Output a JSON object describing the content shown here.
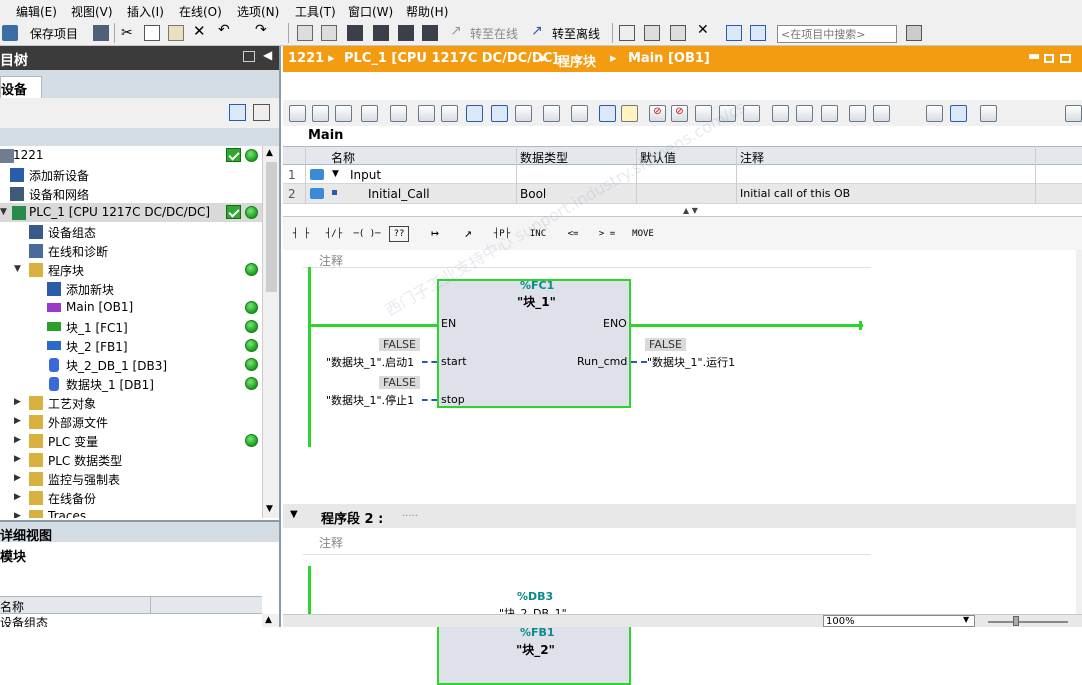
{
  "menu": [
    "编辑(E)",
    "视图(V)",
    "插入(I)",
    "在线(O)",
    "选项(N)",
    "工具(T)",
    "窗口(W)",
    "帮助(H)"
  ],
  "toolbar": {
    "save_project": "保存项目",
    "go_online": "转至在线",
    "go_offline": "转至离线",
    "search_placeholder": "<在项目中搜索>"
  },
  "project_tree": {
    "title": "目树",
    "tab": "设备",
    "items": [
      {
        "label": "1221",
        "status": "check"
      },
      {
        "label": "添加新设备",
        "status": ""
      },
      {
        "label": "设备和网络",
        "status": ""
      },
      {
        "label": "PLC_1 [CPU 1217C DC/DC/DC]",
        "status": "check"
      },
      {
        "label": "设备组态",
        "status": ""
      },
      {
        "label": "在线和诊断",
        "status": ""
      },
      {
        "label": "程序块",
        "status": "ok"
      },
      {
        "label": "添加新块",
        "status": ""
      },
      {
        "label": "Main [OB1]",
        "status": "ok"
      },
      {
        "label": "块_1 [FC1]",
        "status": "ok"
      },
      {
        "label": "块_2 [FB1]",
        "status": "ok"
      },
      {
        "label": "块_2_DB_1 [DB3]",
        "status": "ok"
      },
      {
        "label": "数据块_1 [DB1]",
        "status": "ok"
      },
      {
        "label": "工艺对象",
        "status": ""
      },
      {
        "label": "外部源文件",
        "status": ""
      },
      {
        "label": "PLC 变量",
        "status": "ok"
      },
      {
        "label": "PLC 数据类型",
        "status": ""
      },
      {
        "label": "监控与强制表",
        "status": ""
      },
      {
        "label": "在线备份",
        "status": ""
      },
      {
        "label": "Traces",
        "status": ""
      }
    ]
  },
  "detail_view": {
    "title": "详细视图",
    "sub": "模块",
    "column": "名称",
    "row": "设备组态"
  },
  "breadcrumb": {
    "p1": "1221",
    "p2": "PLC_1 [CPU 1217C DC/DC/DC]",
    "p3": "程序块",
    "p4": "Main [OB1]"
  },
  "interface": {
    "title": "Main",
    "headers": [
      "名称",
      "数据类型",
      "默认值",
      "注释"
    ],
    "rows": [
      {
        "num": "1",
        "name": "Input",
        "type": "",
        "default": "",
        "comment": ""
      },
      {
        "num": "2",
        "name": "Initial_Call",
        "type": "Bool",
        "default": "",
        "comment": "Initial call of this OB"
      }
    ]
  },
  "ladder_tools": [
    "┤ ├",
    "┤/├",
    "─( )─",
    "??",
    "↦",
    "↗",
    "┤P├",
    "INC",
    "<=",
    "> =",
    "MOVE"
  ],
  "network1": {
    "comment": "注释",
    "block_addr": "%FC1",
    "block_name": "\"块_1\"",
    "en": "EN",
    "eno": "ENO",
    "start": "start",
    "stop": "stop",
    "out": "Run_cmd",
    "val_start": "FALSE",
    "tag_start": "\"数据块_1\".启动1",
    "val_stop": "FALSE",
    "tag_stop": "\"数据块_1\".停止1",
    "val_out": "FALSE",
    "tag_out": "\"数据块_1\".运行1"
  },
  "network2": {
    "title": "程序段 2 :",
    "dots": ".....",
    "comment": "注释",
    "db_addr": "%DB3",
    "db_name": "\"块_2_DB_1\"",
    "fb_addr": "%FB1",
    "fb_name": "\"块_2\""
  },
  "status": {
    "zoom": "100%"
  },
  "watermark": "西门子工业支持中心 support.industry.siemens.com/cs"
}
